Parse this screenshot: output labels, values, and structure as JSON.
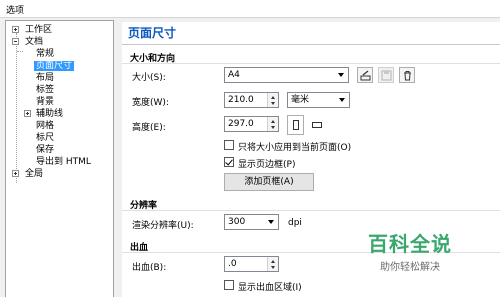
{
  "window": {
    "title": "选项"
  },
  "tree": {
    "items": [
      {
        "label": "工作区",
        "level": 0,
        "toggle": "plus"
      },
      {
        "label": "文档",
        "level": 0,
        "toggle": "minus"
      },
      {
        "label": "常规",
        "level": 1
      },
      {
        "label": "页面尺寸",
        "level": 1,
        "selected": true
      },
      {
        "label": "布局",
        "level": 1
      },
      {
        "label": "标签",
        "level": 1
      },
      {
        "label": "背景",
        "level": 1
      },
      {
        "label": "辅助线",
        "level": 1,
        "toggle": "plus"
      },
      {
        "label": "网格",
        "level": 1
      },
      {
        "label": "标尺",
        "level": 1
      },
      {
        "label": "保存",
        "level": 1
      },
      {
        "label": "导出到 HTML",
        "level": 1
      },
      {
        "label": "全局",
        "level": 0,
        "toggle": "plus"
      }
    ]
  },
  "panel": {
    "title": "页面尺寸",
    "size_section": {
      "heading": "大小和方向",
      "size_label": "大小(S):",
      "size_value": "A4",
      "width_label": "宽度(W):",
      "width_value": "210.0",
      "unit_value": "毫米",
      "height_label": "高度(E):",
      "height_value": "297.0",
      "apply_all_label": "只将大小应用到当前页面(O)",
      "apply_all_checked": false,
      "show_border_label": "显示页边框(P)",
      "show_border_checked": true,
      "add_frame_button": "添加页框(A)"
    },
    "resolution_section": {
      "heading": "分辨率",
      "render_label": "渲染分辨率(U):",
      "render_value": "300",
      "render_unit": "dpi"
    },
    "bleed_section": {
      "heading": "出血",
      "bleed_label": "出血(B):",
      "bleed_value": ".0",
      "show_bleed_label": "显示出血区域(I)",
      "show_bleed_checked": false
    }
  },
  "watermark": {
    "title": "百科全说",
    "subtitle": "助你轻松解决"
  },
  "icons": {
    "save_preset": "save-preset-icon",
    "save_disk": "floppy-disk-icon",
    "delete": "trash-icon",
    "portrait": "portrait-page-icon",
    "landscape": "landscape-page-icon"
  },
  "colors": {
    "accent": "#0a58c0",
    "selection": "#3399ff",
    "watermark": "#3aa76d"
  }
}
